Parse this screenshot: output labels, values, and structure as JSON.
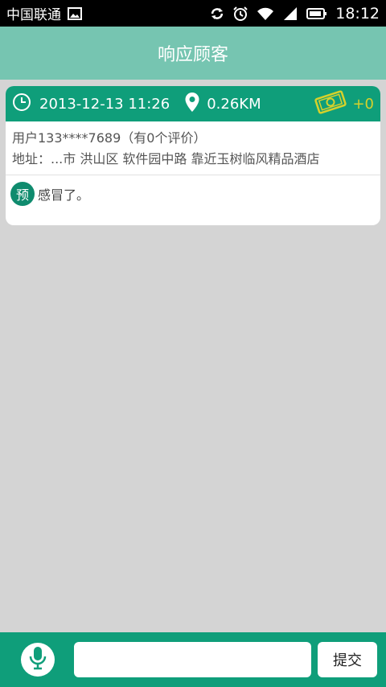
{
  "statusbar": {
    "carrier": "中国联通",
    "time": "18:12",
    "icons": [
      "image-icon",
      "sync-icon",
      "alarm-icon",
      "wifi-icon",
      "signal-icon",
      "battery-icon"
    ]
  },
  "header": {
    "title": "响应顾客"
  },
  "order": {
    "datetime": "2013-12-13  11:26",
    "distance": "0.26KM",
    "reward": "+0",
    "user": "用户133****7689（有0个评价）",
    "address": "地址：...市 洪山区 软件园中路 靠近玉树临风精品酒店",
    "badge": "预",
    "message": "感冒了。"
  },
  "footer": {
    "input_placeholder": "",
    "submit_label": "提交"
  },
  "colors": {
    "accent": "#0f9e7a",
    "title_bg": "#76c5b1",
    "reward": "#d6d12b",
    "background": "#d4d4d4"
  }
}
